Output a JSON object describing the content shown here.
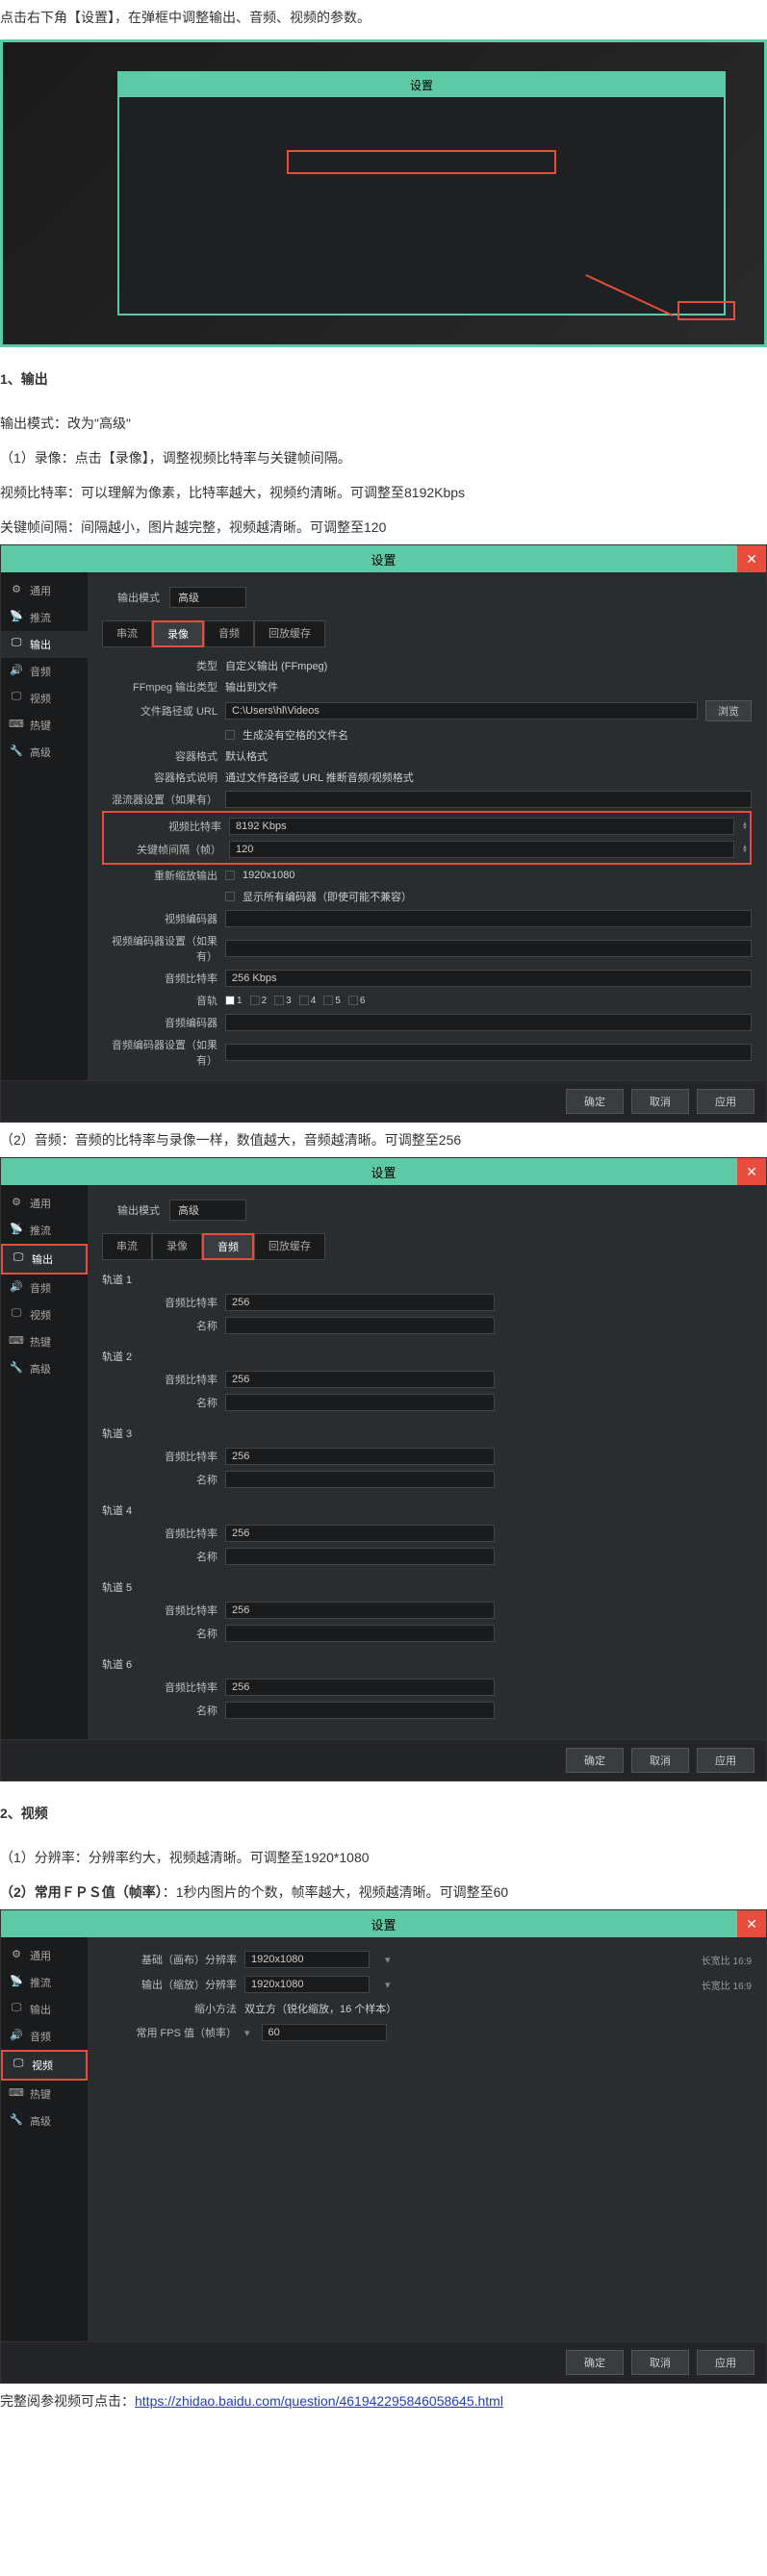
{
  "intro": "点击右下角【设置】，在弹框中调整输出、音频、视频的参数。",
  "dialog_title": "设置",
  "sidebar": {
    "items": [
      {
        "icon": "⚙",
        "label": "通用"
      },
      {
        "icon": "📡",
        "label": "推流"
      },
      {
        "icon": "🖵",
        "label": "输出"
      },
      {
        "icon": "🔊",
        "label": "音频"
      },
      {
        "icon": "🖵",
        "label": "视频"
      },
      {
        "icon": "⌨",
        "label": "热键"
      },
      {
        "icon": "🔧",
        "label": "高级"
      }
    ]
  },
  "section1": {
    "heading": "1、输出",
    "mode_line": "输出模式：改为\"高级\"",
    "sub1": "（1）录像：点击【录像】，调整视频比特率与关键帧间隔。",
    "sub2": "视频比特率：可以理解为像素，比特率越大，视频约清晰。可调整至8192Kbps",
    "sub3": "关键帧间隔：间隔越小，图片越完整，视频越清晰。可调整至120",
    "mode_label": "输出模式",
    "mode_value": "高级",
    "tabs": [
      "串流",
      "录像",
      "音频",
      "回放缓存"
    ],
    "fields": {
      "type_label": "类型",
      "type_value": "自定义输出 (FFmpeg)",
      "ffmpeg_label": "FFmpeg 输出类型",
      "ffmpeg_value": "输出到文件",
      "path_label": "文件路径或 URL",
      "path_value": "C:\\Users\\hl\\Videos",
      "browse": "浏览",
      "filename_label": "",
      "filename_value": "生成没有空格的文件名",
      "container_label": "容器格式",
      "container_value": "默认格式",
      "container_desc_label": "容器格式说明",
      "container_desc_value": "通过文件路径或 URL 推断音频/视频格式",
      "muxer_label": "混流器设置（如果有）",
      "vbitrate_label": "视频比特率",
      "vbitrate_value": "8192 Kbps",
      "keyframe_label": "关键帧间隔（帧）",
      "keyframe_value": "120",
      "rescale_label": "重新缩放输出",
      "rescale_value": "1920x1080",
      "show_encoders": "显示所有编码器（即使可能不兼容）",
      "vencoder_label": "视频编码器",
      "vencoder_settings_label": "视频编码器设置（如果有）",
      "abitrate_label": "音频比特率",
      "abitrate_value": "256 Kbps",
      "track_label": "音轨",
      "tracks": [
        "1",
        "2",
        "3",
        "4",
        "5",
        "6"
      ],
      "aencoder_label": "音频编码器",
      "aencoder_settings_label": "音频编码器设置（如果有）"
    }
  },
  "section2": {
    "text": "（2）音频：音频的比特率与录像一样，数值越大，音频越清晰。可调整至256",
    "tracks": [
      {
        "name": "轨道 1",
        "bitrate_label": "音频比特率",
        "bitrate_value": "256",
        "name_label": "名称"
      },
      {
        "name": "轨道 2",
        "bitrate_label": "音频比特率",
        "bitrate_value": "256",
        "name_label": "名称"
      },
      {
        "name": "轨道 3",
        "bitrate_label": "音频比特率",
        "bitrate_value": "256",
        "name_label": "名称"
      },
      {
        "name": "轨道 4",
        "bitrate_label": "音频比特率",
        "bitrate_value": "256",
        "name_label": "名称"
      },
      {
        "name": "轨道 5",
        "bitrate_label": "音频比特率",
        "bitrate_value": "256",
        "name_label": "名称"
      },
      {
        "name": "轨道 6",
        "bitrate_label": "音频比特率",
        "bitrate_value": "256",
        "name_label": "名称"
      }
    ]
  },
  "section3": {
    "heading": "2、视频",
    "sub1": "（1）分辨率：分辨率约大，视频越清晰。可调整至1920*1080",
    "sub2_before": "（2）常用ＦＰＳ值（帧率）",
    "sub2_after": "：1秒内图片的个数，帧率越大，视频越清晰。可调整至60",
    "base_label": "基础（画布）分辨率",
    "base_value": "1920x1080",
    "output_label": "输出（缩放）分辨率",
    "output_value": "1920x1080",
    "scale_label": "缩小方法",
    "scale_value": "双立方（锐化缩放，16 个样本）",
    "fps_label": "常用 FPS 值（帧率）",
    "fps_value": "60",
    "ratio_text": "长宽比 16:9"
  },
  "footer": {
    "ok": "确定",
    "cancel": "取消",
    "apply": "应用"
  },
  "ending": {
    "text_before": "完整阅参视频可点击：",
    "link": "https://zhidao.baidu.com/question/461942295846058645.html"
  }
}
